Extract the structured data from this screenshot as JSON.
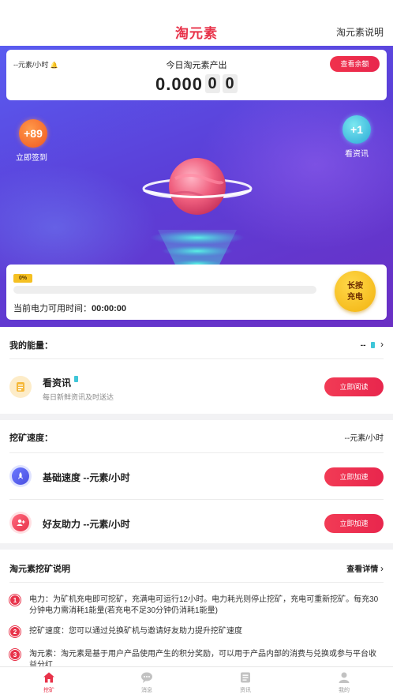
{
  "header": {
    "title": "淘元素",
    "help_link": "淘元素说明"
  },
  "hero": {
    "rate_text": "--元素/小时",
    "today_label": "今日淘元素产出",
    "amount_main": "0.000",
    "amount_digit_1": "0",
    "amount_digit_2": "0",
    "balance_button": "查看余额",
    "checkin_badge": "+89",
    "checkin_label": "立即签到",
    "news_badge": "+1",
    "news_label": "看资讯",
    "power_percent_text": "0%",
    "power_fraction": 0,
    "power_available_label": "当前电力可用时间：",
    "power_available_time": "00:00:00",
    "charge_button_line1": "长按",
    "charge_button_line2": "充电"
  },
  "energy": {
    "title": "我的能量：",
    "value": "--",
    "task": {
      "title": "看资讯",
      "subtitle": "每日新鲜资讯及时送达",
      "button": "立即阅读"
    }
  },
  "speed": {
    "title": "挖矿速度：",
    "value": "--元素/小时",
    "rows": [
      {
        "title": "基础速度 --元素/小时",
        "button": "立即加速"
      },
      {
        "title": "好友助力 --元素/小时",
        "button": "立即加速"
      }
    ]
  },
  "explain": {
    "title": "淘元素挖矿说明",
    "detail_link": "查看详情",
    "items": [
      {
        "num": "1",
        "text": "电力：为矿机充电即可挖矿，充满电可运行12小时。电力耗光则停止挖矿，充电可重新挖矿。每充30分钟电力需消耗1能量(若充电不足30分钟仍消耗1能量)"
      },
      {
        "num": "2",
        "text": "挖矿速度：您可以通过兑换矿机与邀请好友助力提升挖矿速度"
      },
      {
        "num": "3",
        "text": "淘元素：淘元素是基于用户产品使用产生的积分奖励，可以用于产品内部的消费与兑换或参与平台收益分红"
      }
    ]
  },
  "tabbar": {
    "tabs": [
      {
        "label": "挖矿",
        "icon": "home-icon"
      },
      {
        "label": "消息",
        "icon": "chat-icon"
      },
      {
        "label": "资讯",
        "icon": "news-icon"
      },
      {
        "label": "我的",
        "icon": "user-icon"
      }
    ]
  },
  "colors": {
    "accent": "#e8334a",
    "hero_start": "#5a5cf0",
    "hero_end": "#6a2fc4",
    "charge": "#f2b20e"
  }
}
